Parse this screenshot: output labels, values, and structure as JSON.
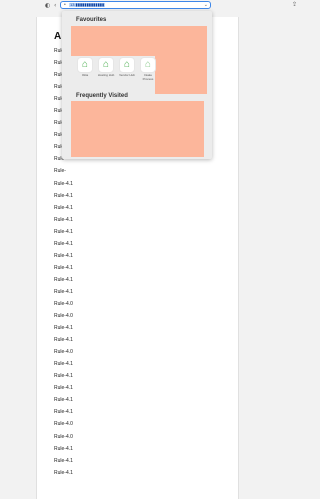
{
  "toolbar": {
    "url": "ℹ️ 13 ℹ️ ℹ️ ℹ️ ℹ️ ℹ️ ℹ️ ℹ️ ℹ️ ℹ️ ℹ️ ℹ️ ℹ️ ℹ️ ℹ️ ℹ️ ℹ️ ℹ️ ℹ️ ℹ️ ℹ️ ℹ️ ℹ️ ℹ️ ℹ️ ℹ️ ℹ️ ℹ️ ℹ️ ℹ️",
    "icons": {
      "sidebar": "sidebar-icon",
      "back": "back-icon",
      "lock": "lock-icon",
      "dropdown": "chevron-down-icon",
      "share": "share-icon"
    },
    "accent_color": "#3d86e8"
  },
  "page": {
    "heading": "A",
    "rules": [
      "Rule-",
      "Rule-",
      "Rule-",
      "Rule-",
      "Rule-",
      "Rule-",
      "Rule-",
      "Rule-",
      "Rule-",
      "Rule-",
      "Rule-",
      "Rule-4.1",
      "Rule-4.1",
      "Rule-4.1",
      "Rule-4.1",
      "Rule-4.1",
      "Rule-4.1",
      "Rule-4.1",
      "Rule-4.1",
      "Rule-4.1",
      "Rule-4.1",
      "Rule-4.0",
      "Rule-4.0",
      "Rule-4.1",
      "Rule-4.1",
      "Rule-4.0",
      "Rule-4.1",
      "Rule-4.1",
      "Rule-4.1",
      "Rule-4.1",
      "Rule-4.1",
      "Rule-4.0",
      "Rule-4.0",
      "Rule-4.1",
      "Rule-4.1",
      "Rule-4.1"
    ]
  },
  "favourites": {
    "title": "Favourites",
    "tiles": [
      {
        "label": "Okta",
        "icon": "house-icon"
      },
      {
        "label": "Hosting Hub",
        "icon": "house-icon"
      },
      {
        "label": "Vendor Hub",
        "icon": "house-icon"
      },
      {
        "label": "Intake Process",
        "icon": "house-icon"
      }
    ]
  },
  "frequently_visited": {
    "title": "Frequently Visited"
  },
  "colors": {
    "placeholder_fill": "#fcb69b",
    "panel_background": "#ececec",
    "tile_icon": "#4caf50"
  }
}
